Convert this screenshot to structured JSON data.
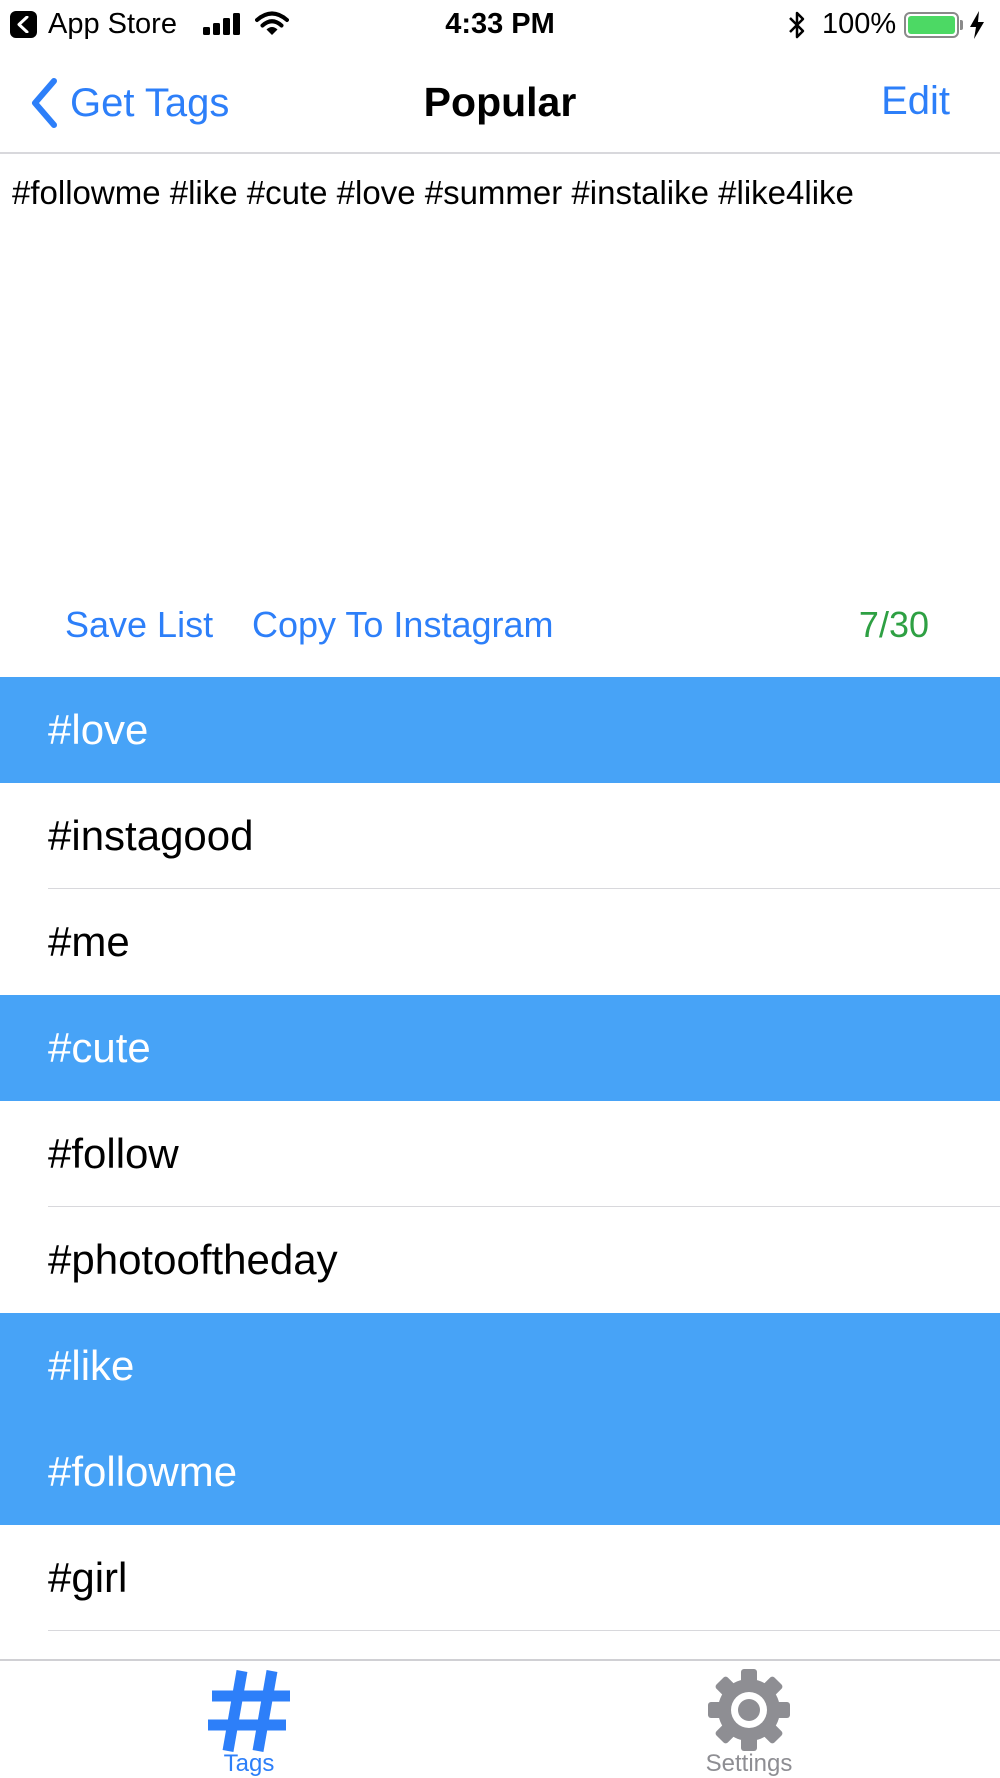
{
  "status_bar": {
    "back_app": "App Store",
    "time": "4:33 PM",
    "battery_percent": "100%",
    "battery_level": 1.0
  },
  "nav": {
    "back_label": "Get Tags",
    "title": "Popular",
    "edit_label": "Edit"
  },
  "selected_text": "#followme #like #cute #love #summer #instalike #like4like",
  "actions": {
    "save_list": "Save List",
    "copy_to_instagram": "Copy To Instagram",
    "counter": "7/30"
  },
  "colors": {
    "accent": "#2d7ff9",
    "selected_row": "#47a3f7",
    "counter_green": "#2ea043",
    "inactive_tab": "#8e8e93"
  },
  "tags": [
    {
      "label": "#love",
      "selected": true
    },
    {
      "label": "#instagood",
      "selected": false
    },
    {
      "label": "#me",
      "selected": false
    },
    {
      "label": "#cute",
      "selected": true
    },
    {
      "label": "#follow",
      "selected": false
    },
    {
      "label": "#photooftheday",
      "selected": false
    },
    {
      "label": "#like",
      "selected": true
    },
    {
      "label": "#followme",
      "selected": true
    },
    {
      "label": "#girl",
      "selected": false
    }
  ],
  "tabs": [
    {
      "label": "Tags",
      "icon": "hashtag-icon",
      "active": true
    },
    {
      "label": "Settings",
      "icon": "gear-icon",
      "active": false
    }
  ]
}
